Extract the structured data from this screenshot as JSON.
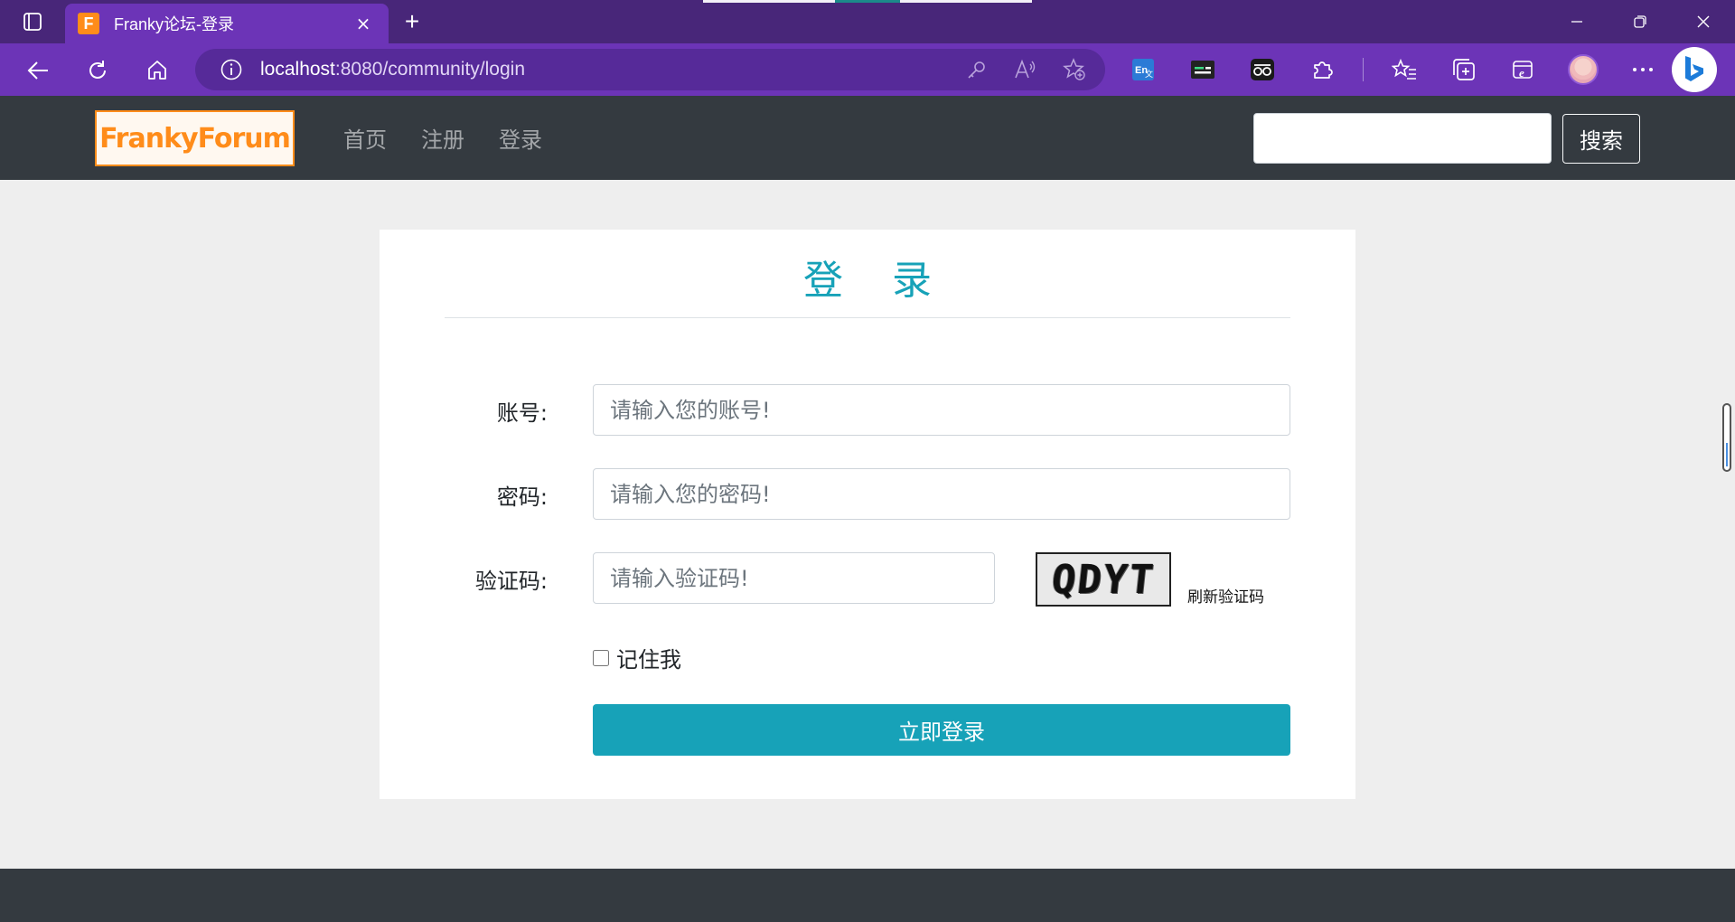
{
  "browser": {
    "tab": {
      "favicon_letter": "F",
      "title": "Franky论坛-登录",
      "close": "×"
    },
    "new_tab": "+",
    "url_host": "localhost",
    "url_rest": ":8080/community/login",
    "colors": {
      "frame": "#482679",
      "toolbar": "#6c34b7",
      "address": "#562a99"
    }
  },
  "site": {
    "brand": "FrankyForum",
    "nav": [
      {
        "label": "首页"
      },
      {
        "label": "注册"
      },
      {
        "label": "登录"
      }
    ],
    "search": {
      "value": "",
      "button": "搜索"
    },
    "colors": {
      "navbar": "#343a40",
      "brand": "#ff8c1a",
      "primary": "#17a2b8"
    }
  },
  "login": {
    "title": "登 录",
    "account": {
      "label": "账号:",
      "placeholder": "请输入您的账号!"
    },
    "password": {
      "label": "密码:",
      "placeholder": "请输入您的密码!"
    },
    "captcha": {
      "label": "验证码:",
      "placeholder": "请输入验证码!",
      "image_text": "QDYT",
      "refresh": "刷新验证码"
    },
    "remember": {
      "label": "记住我",
      "checked": false
    },
    "submit": "立即登录"
  }
}
